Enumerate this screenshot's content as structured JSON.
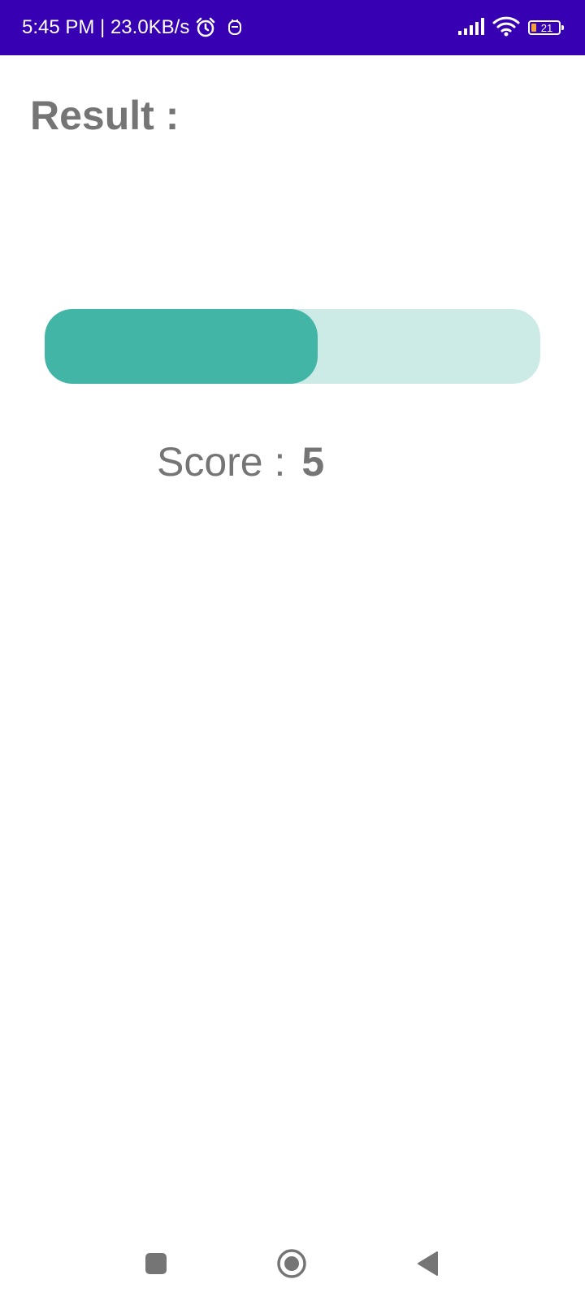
{
  "status_bar": {
    "time_speed": "5:45 PM | 23.0KB/s",
    "battery_level": "21",
    "icons": [
      "alarm-icon",
      "notification-icon",
      "signal-icon",
      "wifi-icon",
      "battery-icon"
    ],
    "background_color": "#3700b3"
  },
  "result": {
    "title": "Result :"
  },
  "progress": {
    "value_fraction": 0.55,
    "fill_color": "#42b5a6",
    "track_color": "#ccebe7"
  },
  "score": {
    "label": "Score :",
    "value": "5"
  },
  "nav_bar": {
    "icons": [
      "recents-square-icon",
      "home-circle-icon",
      "back-triangle-icon"
    ]
  }
}
